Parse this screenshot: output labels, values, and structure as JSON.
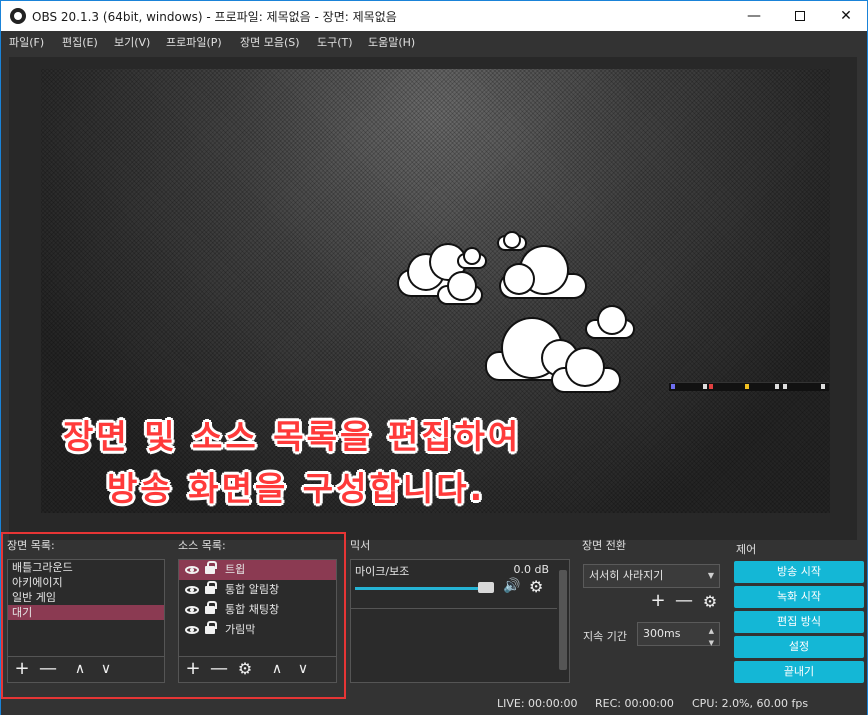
{
  "window": {
    "title": "OBS 20.1.3 (64bit, windows) - 프로파일: 제목없음 - 장면: 제목없음",
    "minimize": "—",
    "close": "✕"
  },
  "menu": [
    "파일(F)",
    "편집(E)",
    "보기(V)",
    "프로파일(P)",
    "장면 모음(S)",
    "도구(T)",
    "도움말(H)"
  ],
  "preview": {
    "overlay_line1": "장면 및 소스 목록을 편집하여",
    "overlay_line2": "방송 화면을 구성합니다."
  },
  "scenes": {
    "title": "장면 목록:",
    "items": [
      "배틀그라운드",
      "아키에이지",
      "일반 게임",
      "대기"
    ],
    "selected": "대기",
    "toolbar": {
      "add": "+",
      "remove": "—",
      "up": "∧",
      "down": "∨"
    }
  },
  "sources": {
    "title": "소스 목록:",
    "items": [
      "트윕",
      "통합 알림창",
      "통합 채팅창",
      "가림막"
    ],
    "selected": "트윕",
    "toolbar": {
      "add": "+",
      "remove": "—",
      "settings": "⚙",
      "up": "∧",
      "down": "∨"
    }
  },
  "mixer": {
    "title": "믹서",
    "track_name": "마이크/보조",
    "db": "0.0 dB",
    "volume_level": 0.95,
    "speaker": "🔊",
    "settings": "⚙"
  },
  "transitions": {
    "title": "장면 전환",
    "selected": "서서히 사라지기",
    "add": "+",
    "remove": "—",
    "settings": "⚙",
    "duration_label": "지속 기간",
    "duration_value": "300ms"
  },
  "controls": {
    "title": "제어",
    "buttons": [
      "방송 시작",
      "녹화 시작",
      "편집 방식",
      "설정",
      "끝내기"
    ]
  },
  "status": {
    "live": "LIVE: 00:00:00",
    "rec": "REC: 00:00:00",
    "cpu": "CPU: 2.0%, 60.00 fps"
  },
  "colors": {
    "accent": "#14b7d6",
    "selection": "#8b3a52",
    "highlight_box": "#e63535",
    "overlay_text": "#ff3a3a"
  }
}
